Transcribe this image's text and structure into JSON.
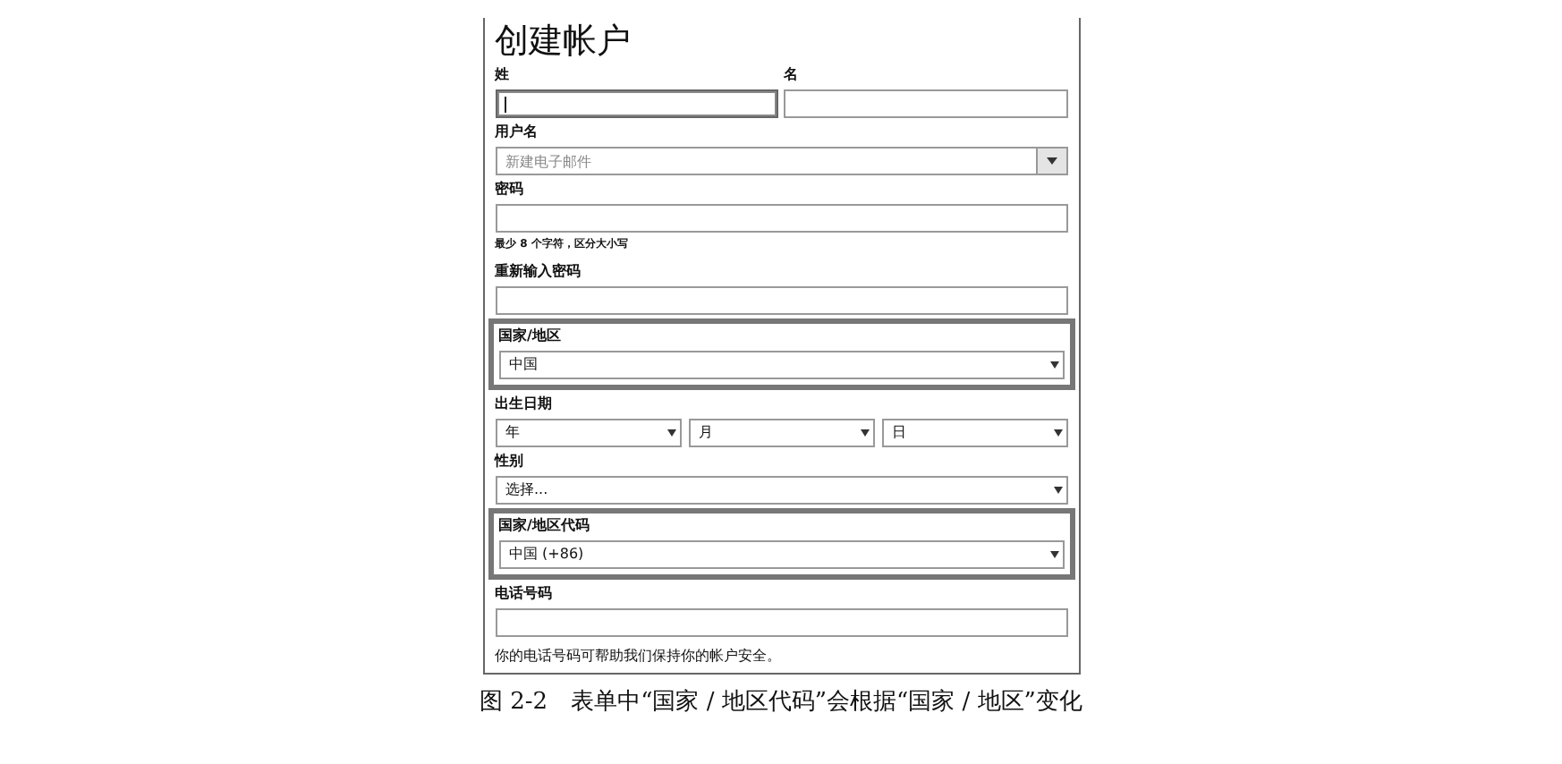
{
  "form": {
    "title": "创建帐户",
    "fields": [
      {
        "kind": "pair",
        "items": [
          {
            "label": "姓",
            "focused": true
          },
          {
            "label": "名",
            "focused": false
          }
        ]
      },
      {
        "kind": "combo",
        "label": "用户名",
        "placeholder": "新建电子邮件"
      },
      {
        "kind": "text",
        "label": "密码",
        "hint": "最少 8 个字符，区分大小写"
      },
      {
        "kind": "text",
        "label": "重新输入密码"
      },
      {
        "kind": "select",
        "label": "国家/地区",
        "value": "中国",
        "highlighted": true
      },
      {
        "kind": "date",
        "label": "出生日期",
        "selects": [
          "年",
          "月",
          "日"
        ]
      },
      {
        "kind": "select",
        "label": "性别",
        "value": "选择...",
        "highlighted": false
      },
      {
        "kind": "select",
        "label": "国家/地区代码",
        "value": "中国 (+86)",
        "highlighted": true
      },
      {
        "kind": "text",
        "label": "电话号码",
        "hint": "你的电话号码可帮助我们保持你的帐户安全。"
      }
    ]
  },
  "caption": "图 2-2　表单中“国家 / 地区代码”会根据“国家 / 地区”变化"
}
